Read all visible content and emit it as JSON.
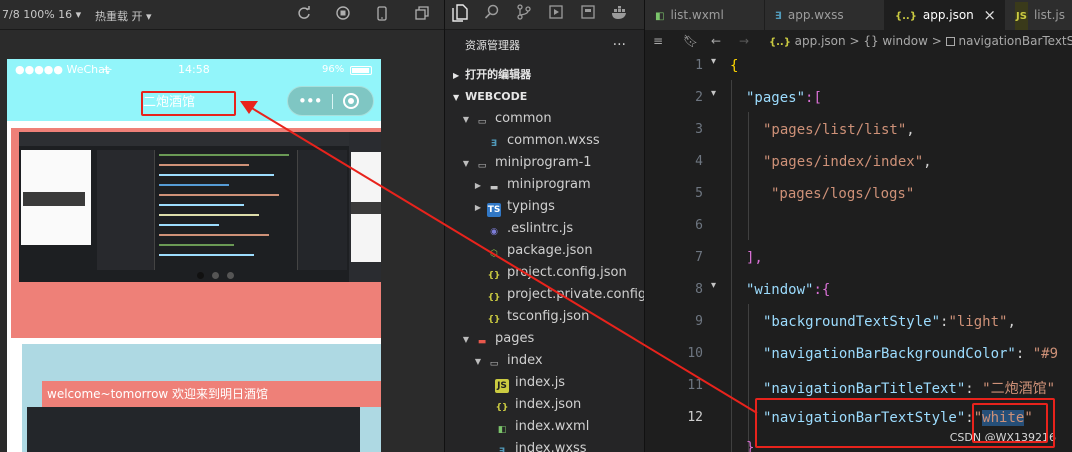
{
  "simulator": {
    "toolbar": {
      "device_info": "7/8 100% 16 ▾",
      "hot_reload": "热重载 开 ▾"
    },
    "phone": {
      "carrier": "●●●●● WeChat",
      "time": "14:58",
      "battery": "96%",
      "nav_title": "二炮酒馆",
      "welcome_text": "welcome~tomorrow 欢迎来到明日酒馆"
    },
    "colors": {
      "nav_bg": "#92f5fa",
      "swiper_bg": "#ee8078",
      "content_bg": "#aed9e3",
      "highlight": "#e8231c"
    }
  },
  "explorer": {
    "title": "资源管理器",
    "more": "···",
    "sections": {
      "open_editors": "打开的编辑器",
      "workspace": "WEBCODE"
    },
    "tree": [
      {
        "label": "common",
        "kind": "folder",
        "icon": "folder-open-icon"
      },
      {
        "label": "common.wxss",
        "kind": "file",
        "icon": "css-file-icon"
      },
      {
        "label": "miniprogram-1",
        "kind": "folder",
        "icon": "folder-open-icon"
      },
      {
        "label": "miniprogram",
        "kind": "folder",
        "icon": "folder-icon"
      },
      {
        "label": "typings",
        "kind": "folder",
        "icon": "ts-folder-icon"
      },
      {
        "label": ".eslintrc.js",
        "kind": "file",
        "icon": "eslint-file-icon"
      },
      {
        "label": "package.json",
        "kind": "file",
        "icon": "node-file-icon"
      },
      {
        "label": "project.config.json",
        "kind": "file",
        "icon": "json-file-icon"
      },
      {
        "label": "project.private.config....",
        "kind": "file",
        "icon": "json-file-icon"
      },
      {
        "label": "tsconfig.json",
        "kind": "file",
        "icon": "json-file-icon"
      },
      {
        "label": "pages",
        "kind": "folder",
        "icon": "pages-folder-icon"
      },
      {
        "label": "index",
        "kind": "folder",
        "icon": "folder-open-icon"
      },
      {
        "label": "index.js",
        "kind": "file",
        "icon": "js-file-icon"
      },
      {
        "label": "index.json",
        "kind": "file",
        "icon": "json-file-icon"
      },
      {
        "label": "index.wxml",
        "kind": "file",
        "icon": "wxml-file-icon"
      },
      {
        "label": "index.wxss",
        "kind": "file",
        "icon": "css-file-icon"
      }
    ]
  },
  "editor": {
    "tabs": [
      {
        "label": "list.wxml",
        "icon_text": "◧",
        "icon_color": "#7bc46b"
      },
      {
        "label": "app.wxss",
        "icon_text": "∃",
        "icon_color": "#519aba"
      },
      {
        "label": "app.json",
        "icon_text": "{..}",
        "icon_color": "#cbcb41"
      },
      {
        "label": "list.js",
        "icon_text": "JS",
        "icon_color": "#cbcb41"
      }
    ],
    "tab_close": "×",
    "breadcrumb": {
      "file": "app.json",
      "sep": ">",
      "node1": "{} window",
      "node2": "navigationBarTextSt"
    },
    "lines": [
      {
        "num": "1"
      },
      {
        "num": "2"
      },
      {
        "num": "3"
      },
      {
        "num": "4"
      },
      {
        "num": "5"
      },
      {
        "num": "6"
      },
      {
        "num": "7"
      },
      {
        "num": "8"
      },
      {
        "num": "9"
      },
      {
        "num": "10"
      },
      {
        "num": "11"
      },
      {
        "num": "12"
      }
    ],
    "code": {
      "l1": "{",
      "l2_key": "\"pages\"",
      "l2_rest": ":[",
      "l3": "\"pages/list/list\"",
      "l4": "\"pages/index/index\"",
      "l5": "\"pages/logs/logs\"",
      "l7": "],",
      "l8_key": "\"window\"",
      "l8_rest": ":{",
      "l9_key": "\"backgroundTextStyle\"",
      "l9_val": "\"light\"",
      "l10_key": "\"navigationBarBackgroundColor\"",
      "l10_val": "\"#9",
      "l11_key": "\"navigationBarTitleText\"",
      "l11_val": "\"二炮酒馆\"",
      "l12_key": "\"navigationBarTextStyle\"",
      "l12_val": "white",
      "comma": ",",
      "colon": ":",
      "colon_sp": ": ",
      "quote": "\"",
      "last": "}"
    },
    "watermark": "CSDN @WX139216"
  }
}
